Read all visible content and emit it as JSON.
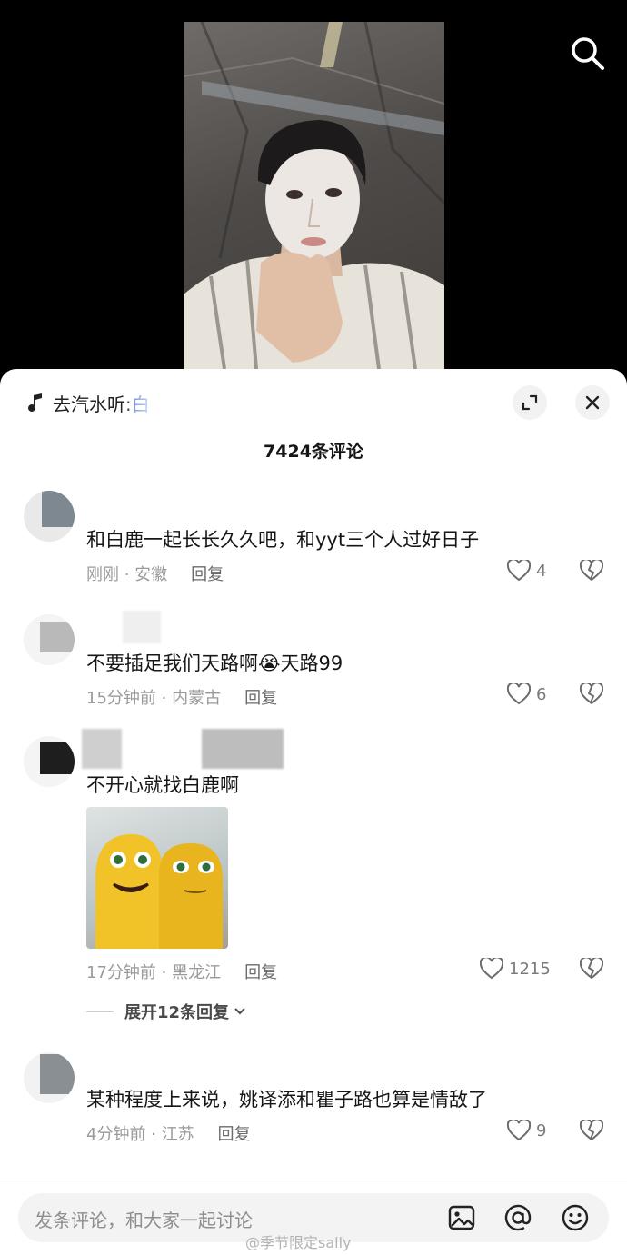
{
  "header": {
    "search_icon": "search-icon"
  },
  "sheet": {
    "music_prefix": "去汽水听:",
    "music_song": "白",
    "comment_count_label": "7424条评论",
    "icons": {
      "expand": "expand-icon",
      "close": "close-icon"
    }
  },
  "comments": [
    {
      "text": "和白鹿一起长长久久吧，和yyt三个人过好日子",
      "time_location": "刚刚 · 安徽",
      "reply": "回复",
      "likes": "4"
    },
    {
      "text": "不要插足我们天路啊",
      "emoji": "😭",
      "text2": "天路99",
      "time_location": "15分钟前 · 内蒙古",
      "reply": "回复",
      "likes": "6"
    },
    {
      "text": "不开心就找白鹿啊",
      "time_location": "17分钟前 · 黑龙江",
      "reply": "回复",
      "likes": "1215",
      "expand_replies": "展开12条回复"
    },
    {
      "text": "某种程度上来说，姚译添和瞿子路也算是情敌了",
      "time_location": "4分钟前 · 江苏",
      "reply": "回复",
      "likes": "9"
    }
  ],
  "bottom_bar": {
    "placeholder": "发条评论，和大家一起讨论",
    "watermark": "@季节限定sally",
    "icons": {
      "image": "image-icon",
      "mention": "at-icon",
      "emoji": "smile-icon"
    }
  },
  "colors": {
    "link": "#3b6fd4",
    "muted": "#9a9a9a",
    "sheet_bg": "#ffffff"
  }
}
